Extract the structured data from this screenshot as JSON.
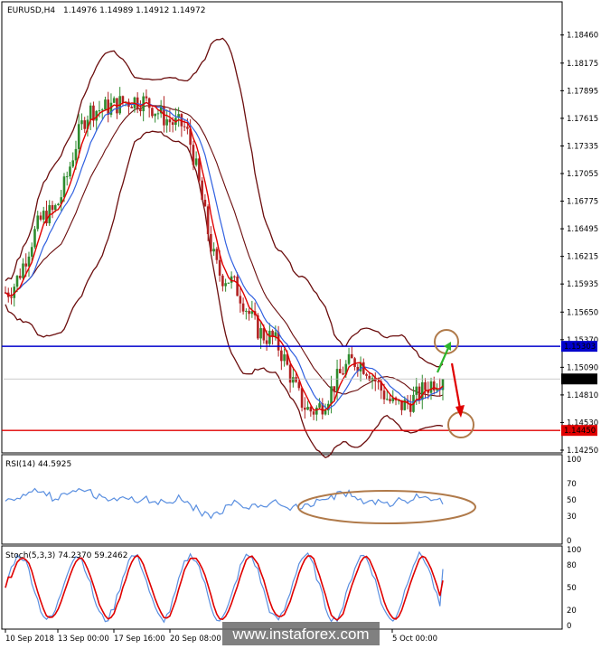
{
  "colors": {
    "bull": "#2e8b2e",
    "bear": "#b22222",
    "band": "#6b0d0d",
    "ma_fast": "#e00000",
    "ma_slow": "#3060e0",
    "resistance": "#0000cc",
    "support": "#e00000",
    "rsi": "#5a8fe0",
    "stoch_main": "#5a8fe0",
    "stoch_signal": "#e00000",
    "annotation_circle": "#b07a4a",
    "arrow_up": "#2db52d",
    "arrow_down": "#e00000"
  },
  "header": {
    "symbol": "EURUSD,H4",
    "ohlc": "1.14976 1.14989 1.14912 1.14972"
  },
  "price_axis": {
    "ticks": [
      "1.18460",
      "1.18175",
      "1.17895",
      "1.17615",
      "1.17335",
      "1.17055",
      "1.16775",
      "1.16495",
      "1.16215",
      "1.15935",
      "1.15650",
      "1.15370",
      "1.15090",
      "1.14810",
      "1.14530",
      "1.14250"
    ],
    "current_price": "1.14972",
    "resistance_label": "1.15303",
    "support_label": "1.14450"
  },
  "rsi_panel": {
    "label": "RSI(14) 44.5925",
    "scale": [
      "100",
      "70",
      "50",
      "30",
      "0"
    ]
  },
  "stoch_panel": {
    "label": "Stoch(5,3,3) 74.2370 59.2462",
    "scale": [
      "100",
      "80",
      "50",
      "20",
      "0"
    ]
  },
  "time_axis": {
    "labels": [
      "10 Sep 2018",
      "13 Sep 00:00",
      "17 Sep 16:00",
      "20 Sep 08:00",
      "5 Oct 00:00"
    ]
  },
  "watermark": "www.instaforex.com",
  "chart_data": {
    "type": "candlestick",
    "title": "EURUSD,H4",
    "ylim": [
      1.1425,
      1.1865
    ],
    "resistance_level": 1.15303,
    "support_level": 1.1445,
    "last_price": 1.14972,
    "key_points": [
      {
        "x": "10 Sep 2018",
        "y": 1.1585
      },
      {
        "x": "17 Sep 16:00",
        "y": 1.1665
      },
      {
        "x": "20 Sep 08:00",
        "y": 1.177
      },
      {
        "x": "24 Sep",
        "y": 1.178
      },
      {
        "x": "26 Sep",
        "y": 1.1755
      },
      {
        "x": "28 Sep",
        "y": 1.16
      },
      {
        "x": "1 Oct",
        "y": 1.154
      },
      {
        "x": "3 Oct",
        "y": 1.1465
      },
      {
        "x": "5 Oct 00:00",
        "y": 1.1515
      },
      {
        "x": "8 Oct",
        "y": 1.147
      },
      {
        "x": "9 Oct",
        "y": 1.14972
      }
    ],
    "rsi_last": 44.5925,
    "stoch_main_last": 74.237,
    "stoch_signal_last": 59.2462
  }
}
